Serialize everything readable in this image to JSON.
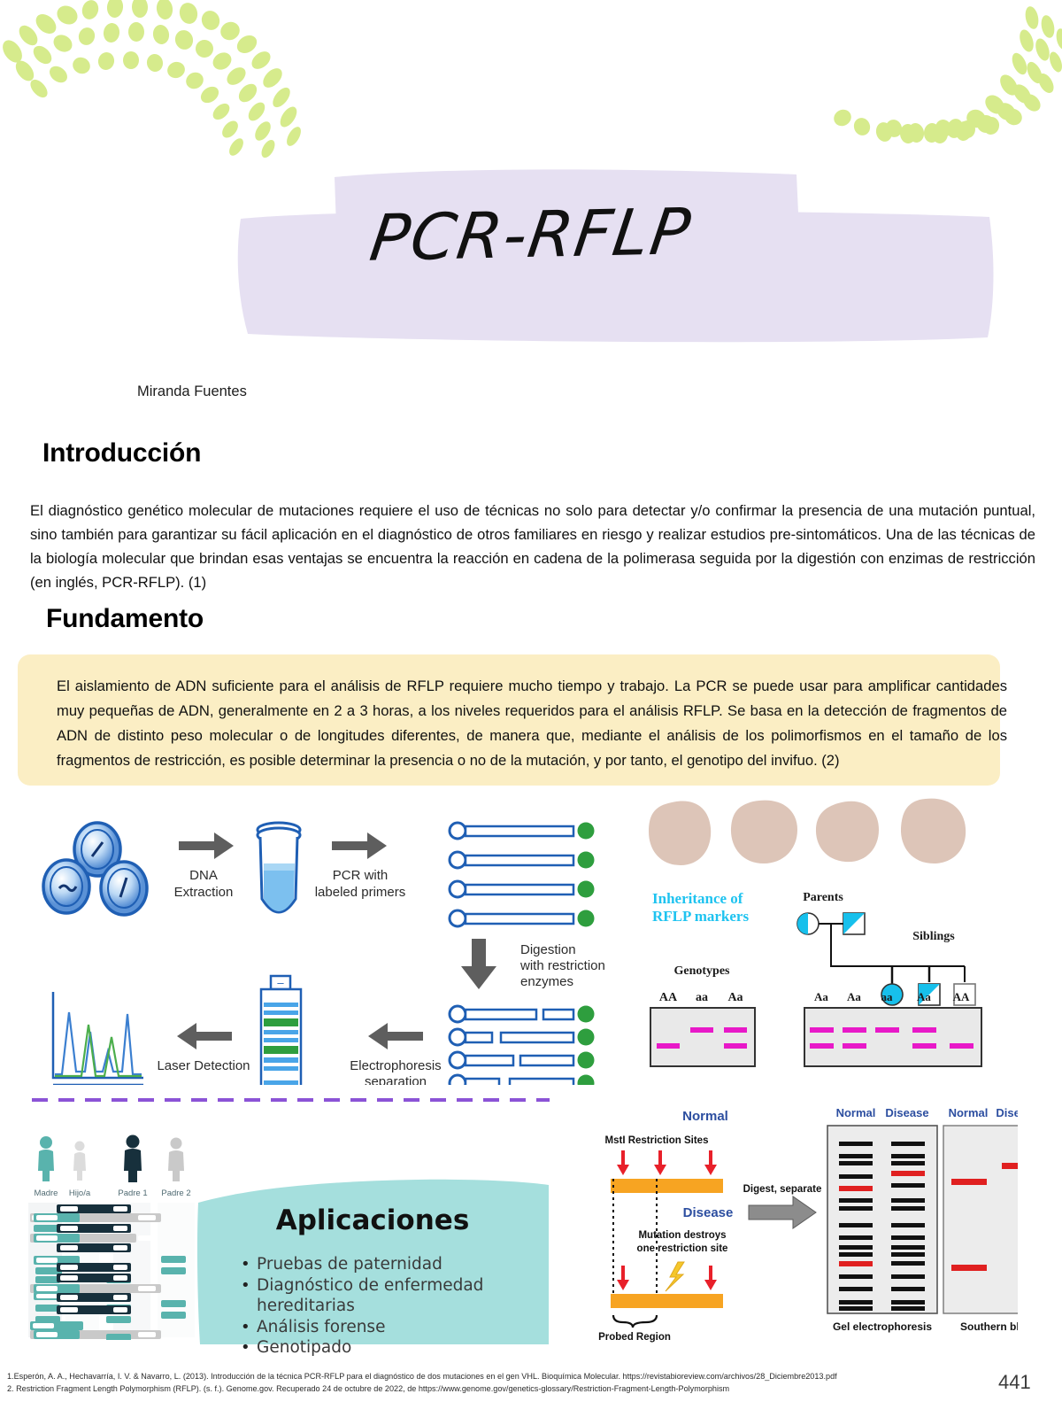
{
  "page": {
    "title": "PCR-RFLP",
    "author": "Miranda Fuentes",
    "page_number": "441",
    "colors": {
      "leaf_green": "#d6eb8c",
      "title_banner": "#e6e0f2",
      "fundamento_box": "#fbeec4",
      "aplicaciones_panel": "#a5dfdd",
      "dashed_divider": "#8b53d6",
      "gel_band_magenta": "#e819c8",
      "pedigree_cyan": "#15b8e0",
      "restriction_orange": "#f7a422",
      "arrow_red": "#e8202a",
      "workflow_blue": "#1f5fb4",
      "workflow_green": "#2e9e3e",
      "paternity_teal": "#59b3ad",
      "paternity_dark": "#17303c"
    }
  },
  "sections": {
    "introduccion": {
      "heading": "Introducción",
      "body": "El diagnóstico genético molecular de mutaciones requiere el uso de técnicas no solo para detectar y/o confirmar la presencia de una mutación puntual, sino también para garantizar su fácil aplicación en el diagnóstico de otros familiares en riesgo y realizar estudios pre-sintomáticos. Una de las técnicas de la biología molecular que brindan esas ventajas se encuentra la reacción en cadena de la polimerasa seguida por la digestión con enzimas de restricción (en inglés, PCR-RFLP).  (1)"
    },
    "fundamento": {
      "heading": "Fundamento",
      "body": "El aislamiento de ADN suficiente para el análisis de RFLP requiere mucho tiempo y trabajo. La PCR se puede usar para amplificar cantidades muy pequeñas de ADN, generalmente en 2 a 3 horas, a los niveles requeridos para el análisis RFLP. Se basa en la detección de fragmentos de ADN de distinto peso molecular o de longitudes diferentes, de manera que, mediante el análisis de los polimorfismos en el tamaño de los fragmentos de restricción, es posible determinar la presencia o no de la mutación, y por tanto, el genotipo del invifuo. (2)"
    },
    "aplicaciones": {
      "heading": "Aplicaciones",
      "items": [
        "Pruebas de paternidad",
        "Diagnóstico de enfermedad hereditarias",
        "Análisis forense",
        "Genotipado"
      ]
    }
  },
  "figures": {
    "workflow": {
      "steps": [
        "DNA\nExtraction",
        "PCR with\nlabeled primers",
        "Digestion\nwith restriction\nenzymes",
        "Electrophoresis\nseparation",
        "Laser Detection"
      ],
      "step_dna_extraction_line1": "DNA",
      "step_dna_extraction_line2": "Extraction",
      "step_pcr_line1": "PCR with",
      "step_pcr_line2": "labeled primers",
      "step_digestion_line1": "Digestion",
      "step_digestion_line2": "with restriction",
      "step_digestion_line3": "enzymes",
      "step_electro_line1": "Electrophoresis",
      "step_electro_line2": "separation",
      "step_laser": "Laser Detection",
      "gel_plus": "+",
      "gel_minus": "–"
    },
    "inheritance": {
      "title_line1": "Inheritance of",
      "title_line2": "RFLP markers",
      "parents_label": "Parents",
      "siblings_label": "Siblings",
      "genotypes_label": "Genotypes",
      "genotype_lanes": [
        "AA",
        "aa",
        "Aa"
      ],
      "genotype_bands": [
        [
          "low"
        ],
        [
          "high"
        ],
        [
          "high",
          "low"
        ]
      ],
      "family_lanes": [
        "Aa",
        "Aa",
        "aa",
        "Aa",
        "AA"
      ],
      "family_bands": [
        [
          "high",
          "low"
        ],
        [
          "high",
          "low"
        ],
        [
          "high"
        ],
        [
          "high",
          "low"
        ],
        [
          "low"
        ]
      ]
    },
    "paternity": {
      "labels": [
        "Madre",
        "Hijo/a",
        "Padre 1",
        "Padre 2"
      ]
    },
    "restriction": {
      "normal_label": "Normal",
      "disease_label": "Disease",
      "sites_label": "MstI Restriction Sites",
      "mutation_line1": "Mutation destroys",
      "mutation_line2": "one restriction site",
      "probed_label": "Probed Region",
      "digest_label": "Digest, separate",
      "gel_caption": "Gel electrophoresis",
      "blot_caption": "Southern blot",
      "gel_lane_normal": "Normal",
      "gel_lane_disease": "Disease",
      "blot_lane_normal": "Normal",
      "blot_lane_disease": "Disease"
    }
  },
  "references": {
    "items": [
      "1.Esperón, A. A., Hechavarría, I. V. & Navarro, L. (2013). Introducción de la técnica PCR-RFLP para el diagnóstico de dos mutaciones en el gen VHL. Bioquímica Molecular. https://revistabioreview.com/archivos/28_Diciembre2013.pdf",
      "2. Restriction Fragment Length Polymorphism (RFLP). (s. f.). Genome.gov. Recuperado 24 de octubre de 2022, de https://www.genome.gov/genetics-glossary/Restriction-Fragment-Length-Polymorphism"
    ]
  }
}
